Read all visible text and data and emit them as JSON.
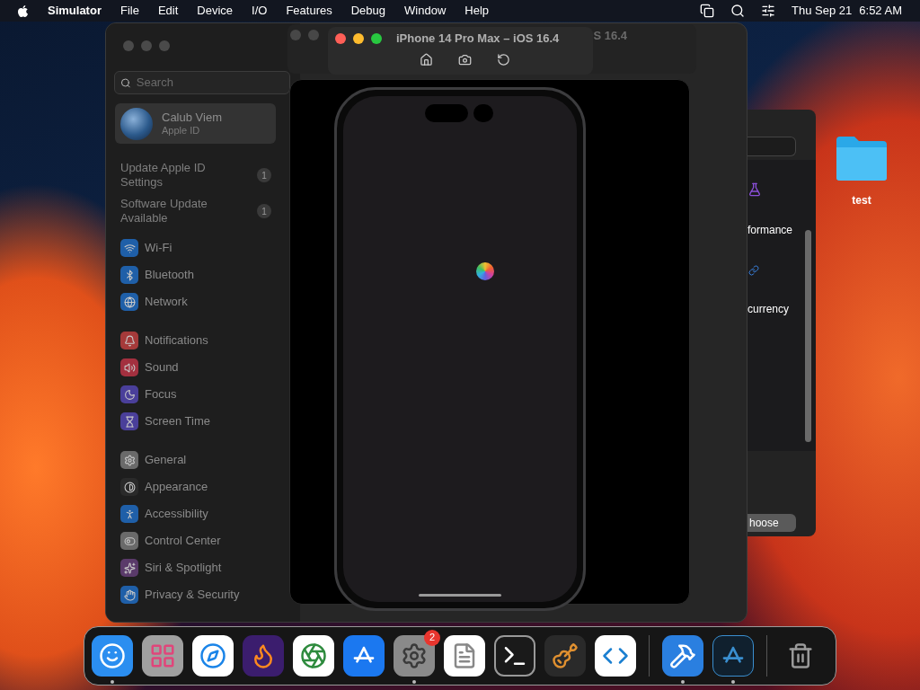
{
  "menu_bar": {
    "app": "Simulator",
    "menus": [
      "File",
      "Edit",
      "Device",
      "I/O",
      "Features",
      "Debug",
      "Window",
      "Help"
    ],
    "date": "Thu Sep 21",
    "time": "6:52 AM"
  },
  "settings_window": {
    "search": {
      "placeholder": "Search"
    },
    "account": {
      "name": "Calub Viem",
      "subtitle": "Apple ID"
    },
    "notices": [
      {
        "label": "Update Apple ID Settings",
        "badge": "1"
      },
      {
        "label": "Software Update Available",
        "badge": "1"
      }
    ],
    "groups": [
      {
        "items": [
          {
            "label": "Wi-Fi",
            "kind": "wifi",
            "color": "#1f5fa8"
          },
          {
            "label": "Bluetooth",
            "kind": "bluetooth",
            "color": "#1f5fa8"
          },
          {
            "label": "Network",
            "kind": "globe",
            "color": "#1f5fa8"
          }
        ]
      },
      {
        "items": [
          {
            "label": "Notifications",
            "kind": "bell",
            "color": "#a53a3a"
          },
          {
            "label": "Sound",
            "kind": "speaker",
            "color": "#a3303f"
          },
          {
            "label": "Focus",
            "kind": "moon",
            "color": "#4a3f9a"
          },
          {
            "label": "Screen Time",
            "kind": "hourglass",
            "color": "#4a3f9a"
          }
        ]
      },
      {
        "items": [
          {
            "label": "General",
            "kind": "gear",
            "color": "#6a6a6a"
          },
          {
            "label": "Appearance",
            "kind": "contrast",
            "color": "#2a2a2a"
          },
          {
            "label": "Accessibility",
            "kind": "person",
            "color": "#1f5fa8"
          },
          {
            "label": "Control Center",
            "kind": "switches",
            "color": "#6a6a6a"
          },
          {
            "label": "Siri & Spotlight",
            "kind": "orb",
            "color": "#5a3a6a"
          },
          {
            "label": "Privacy & Security",
            "kind": "hand",
            "color": "#1f5fa8"
          }
        ]
      }
    ]
  },
  "back_window": {
    "title_fragment": "S 16.4"
  },
  "simulator": {
    "title": "iPhone 14 Pro Max – iOS 16.4"
  },
  "side_window": {
    "texts": [
      "formance",
      "currency"
    ],
    "button": "hoose"
  },
  "desktop": {
    "folder": "test"
  },
  "dock": {
    "sections": [
      {
        "items": [
          {
            "kind": "face",
            "running": true
          },
          {
            "kind": "grid",
            "running": false
          },
          {
            "kind": "compass",
            "running": false
          },
          {
            "kind": "flame",
            "running": false
          },
          {
            "kind": "aperture",
            "running": false
          },
          {
            "kind": "strokes",
            "running": false
          },
          {
            "kind": "gear",
            "running": true,
            "badge": "2"
          },
          {
            "kind": "page",
            "running": false
          },
          {
            "kind": "prompt",
            "running": false
          },
          {
            "kind": "guitar",
            "running": false
          },
          {
            "kind": "code",
            "running": false
          }
        ]
      },
      {
        "items": [
          {
            "kind": "hammer",
            "running": true
          },
          {
            "kind": "outline",
            "running": true
          }
        ]
      },
      {
        "items": [
          {
            "kind": "trash",
            "running": false
          }
        ]
      }
    ]
  }
}
